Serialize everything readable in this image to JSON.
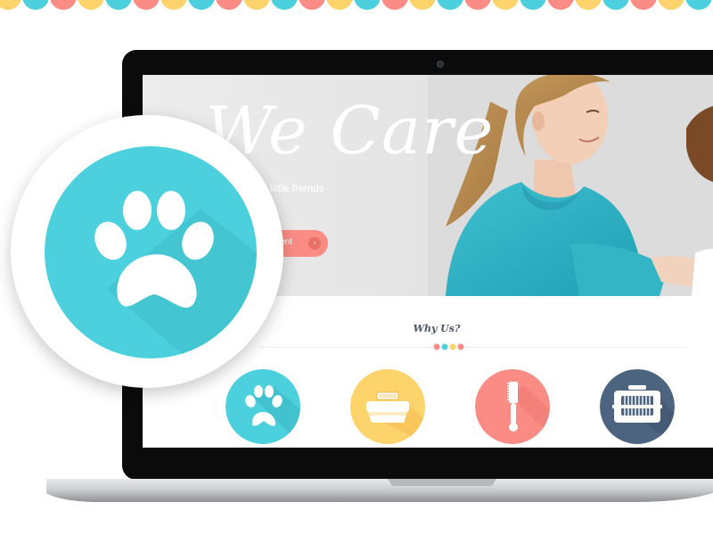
{
  "hero": {
    "title": "We Care",
    "subtitle": "little friends",
    "cta_label": "ment",
    "cta_arrow": "›"
  },
  "section": {
    "heading": "Why Us?"
  },
  "features": [
    {
      "icon": "paw-icon",
      "color": "#4dd0dd"
    },
    {
      "icon": "pet-bed-icon",
      "color": "#fdd36b"
    },
    {
      "icon": "grooming-brush-icon",
      "color": "#fb8c85"
    },
    {
      "icon": "pet-carrier-icon",
      "color": "#4d6480"
    }
  ],
  "badge": {
    "icon": "paw-icon",
    "color": "#4dd0dd"
  },
  "colors": {
    "teal": "#4dd0dd",
    "yellow": "#fdd36b",
    "coral": "#fb8c85",
    "navy": "#4d6480"
  }
}
